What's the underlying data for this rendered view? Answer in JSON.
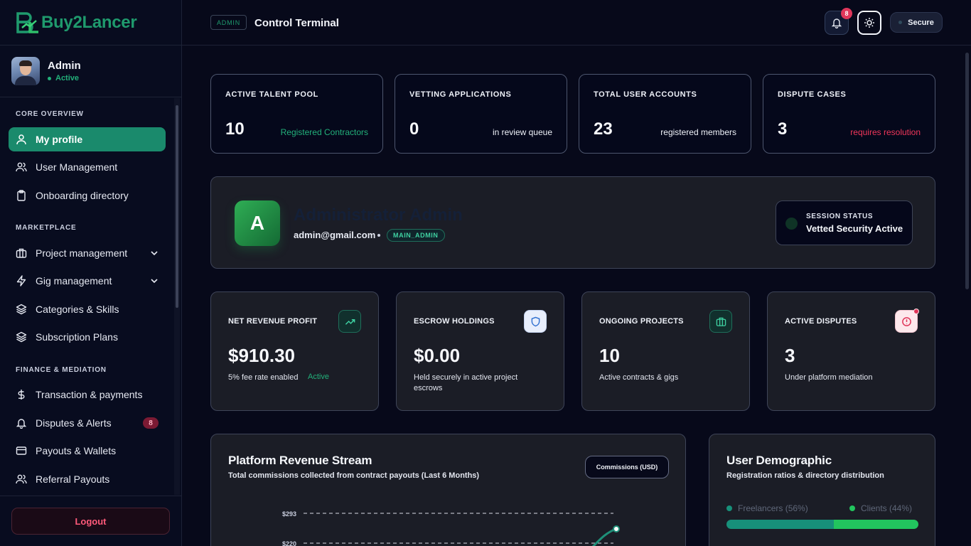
{
  "brand": {
    "name": "Buy2Lancer"
  },
  "user": {
    "name": "Admin",
    "status": "Active"
  },
  "nav": {
    "sections": [
      "CORE OVERVIEW",
      "MARKETPLACE",
      "FINANCE & MEDIATION"
    ],
    "items": [
      {
        "label": "My profile",
        "icon": "user-icon"
      },
      {
        "label": "User Management",
        "icon": "users-icon"
      },
      {
        "label": "Onboarding directory",
        "icon": "clipboard-icon"
      },
      {
        "label": "Project management",
        "icon": "briefcase-icon"
      },
      {
        "label": "Gig management",
        "icon": "lightning-icon"
      },
      {
        "label": "Categories & Skills",
        "icon": "layers-icon"
      },
      {
        "label": "Subscription Plans",
        "icon": "layers-icon"
      },
      {
        "label": "Transaction & payments",
        "icon": "dollar-icon"
      },
      {
        "label": "Disputes & Alerts",
        "icon": "bell-icon",
        "badge": "8"
      },
      {
        "label": "Payouts & Wallets",
        "icon": "card-icon"
      },
      {
        "label": "Referral Payouts",
        "icon": "users-icon"
      }
    ],
    "logout": "Logout"
  },
  "header": {
    "tag": "ADMIN",
    "title": "Control Terminal",
    "notification_count": "8",
    "secure": "Secure"
  },
  "stats": [
    {
      "label": "ACTIVE TALENT POOL",
      "value": "10",
      "note": "Registered Contractors",
      "note_color": "#22b07a"
    },
    {
      "label": "VETTING APPLICATIONS",
      "value": "0",
      "note": "in review queue",
      "note_color": "#eef1f8"
    },
    {
      "label": "TOTAL USER ACCOUNTS",
      "value": "23",
      "note": "registered members",
      "note_color": "#eef1f8"
    },
    {
      "label": "DISPUTE CASES",
      "value": "3",
      "note": "requires resolution",
      "note_color": "#f0365a"
    }
  ],
  "admin_card": {
    "initial": "A",
    "name": "Administrator Admin",
    "email": "admin@gmail.com",
    "role": "MAIN_ADMIN",
    "session_label": "SESSION STATUS",
    "session_value": "Vetted Security Active"
  },
  "kpis": [
    {
      "label": "NET REVENUE PROFIT",
      "value": "$910.30",
      "sub": "5% fee rate enabled",
      "extra": "Active",
      "icon": "trend-up-icon"
    },
    {
      "label": "ESCROW HOLDINGS",
      "value": "$0.00",
      "sub": "Held securely in active project escrows",
      "icon": "shield-icon"
    },
    {
      "label": "ONGOING PROJECTS",
      "value": "10",
      "sub": "Active contracts & gigs",
      "icon": "briefcase-icon"
    },
    {
      "label": "ACTIVE DISPUTES",
      "value": "3",
      "sub": "Under platform mediation",
      "icon": "alert-icon"
    }
  ],
  "revenue_panel": {
    "title": "Platform Revenue Stream",
    "subtitle": "Total commissions collected from contract payouts (Last 6 Months)",
    "button": "Commissions (USD)"
  },
  "chart_data": {
    "type": "area",
    "title": "Platform Revenue Stream",
    "y_ticks": [
      "$293",
      "$220"
    ],
    "ylim_visible": [
      220,
      293
    ],
    "grid": true
  },
  "demographic_panel": {
    "title": "User Demographic",
    "subtitle": "Registration ratios & directory distribution",
    "legend": [
      {
        "label": "Freelancers (56%)",
        "color": "#17907a",
        "value": 56
      },
      {
        "label": "Clients (44%)",
        "color": "#22c55e",
        "value": 44
      }
    ]
  }
}
